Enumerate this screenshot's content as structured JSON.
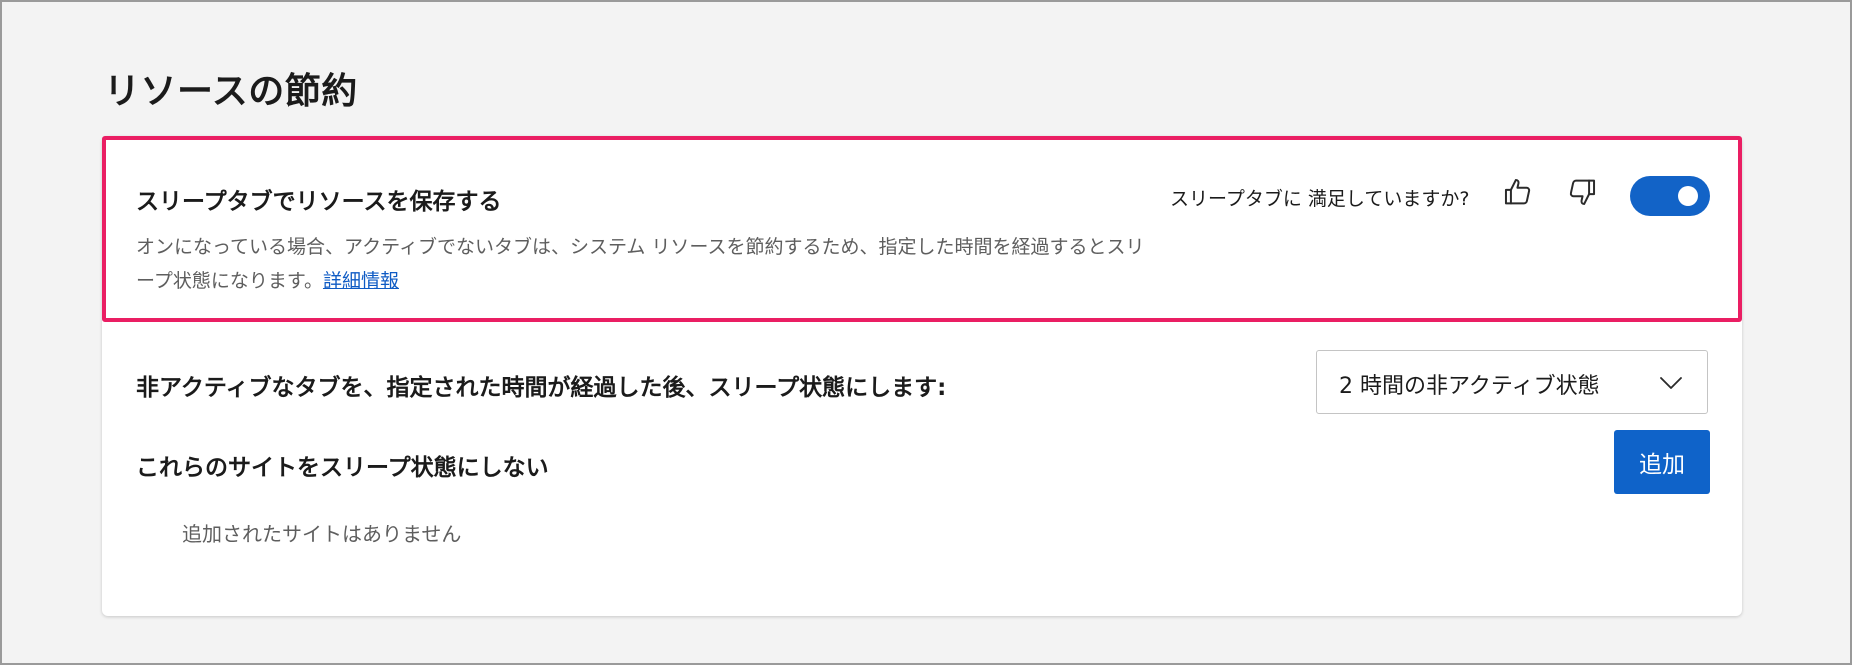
{
  "section": {
    "title": "リソースの節約"
  },
  "sleeping_tabs": {
    "title": "スリープタブでリソースを保存する",
    "description": "オンになっている場合、アクティブでないタブは、システム リソースを節約するため、指定した時間を経過するとスリープ状態になります。",
    "learn_more": "詳細情報",
    "feedback_question": "スリープタブに 満足していますか?",
    "toggle_state": "on",
    "accent_color": "#1263c7",
    "highlight_color": "#ea1e63",
    "icons": {
      "thumbs_up": "thumbs-up-icon",
      "thumbs_down": "thumbs-down-icon"
    }
  },
  "inactive_timeout": {
    "label": "非アクティブなタブを、指定された時間が経過した後、スリープ状態にします:",
    "selected": "2 時間の非アクティブ状態"
  },
  "never_sleep_sites": {
    "label": "これらのサイトをスリープ状態にしない",
    "add_button": "追加",
    "empty_message": "追加されたサイトはありません"
  }
}
